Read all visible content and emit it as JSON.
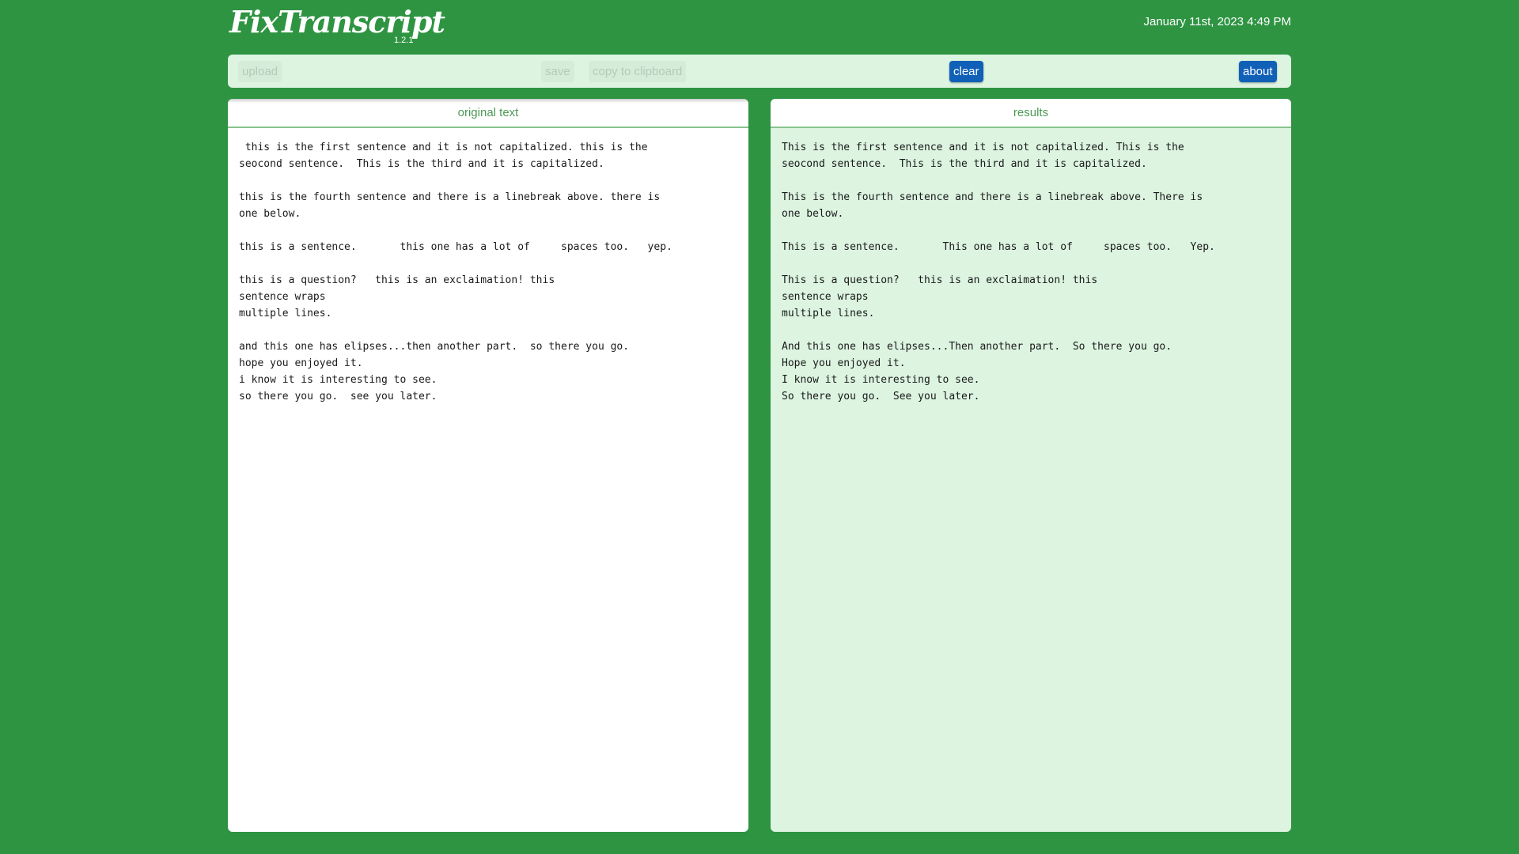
{
  "app": {
    "title": "FixTranscript",
    "version": "1.2.1",
    "datetime": "January 11st, 2023 4:49 PM"
  },
  "toolbar": {
    "upload_label": "upload",
    "save_label": "save",
    "copy_label": "copy to clipboard",
    "clear_label": "clear",
    "about_label": "about"
  },
  "original": {
    "title": "original text",
    "lines": [
      " this is the first sentence and it is not capitalized. this is the",
      "seocond sentence.  This is the third and it is capitalized.",
      "",
      "this is the fourth sentence and there is a linebreak above. there is",
      "one below.",
      "",
      "this is a sentence.       this one has a lot of     spaces too.   yep.",
      "",
      "this is a question?   this is an exclaimation! this",
      "sentence wraps",
      "multiple lines.",
      "",
      "and this one has elipses...then another part.  so there you go.",
      "hope you enjoyed it.",
      "i know it is interesting to see.",
      "so there you go.  see you later."
    ]
  },
  "results": {
    "title": "results",
    "lines": [
      "This is the first sentence and it is not capitalized. This is the",
      "seocond sentence.  This is the third and it is capitalized.",
      "",
      "This is the fourth sentence and there is a linebreak above. There is",
      "one below.",
      "",
      "This is a sentence.       This one has a lot of     spaces too.   Yep.",
      "",
      "This is a question?   this is an exclaimation! this",
      "sentence wraps",
      "multiple lines.",
      "",
      "And this one has elipses...Then another part.  So there you go.",
      "Hope you enjoyed it.",
      "I know it is interesting to see.",
      "So there you go.  See you later."
    ]
  },
  "colors": {
    "background": "#2e9442",
    "toolbar": "#dcf4e0",
    "button_active": "#1060b8",
    "heading_text": "#4c9a54"
  }
}
